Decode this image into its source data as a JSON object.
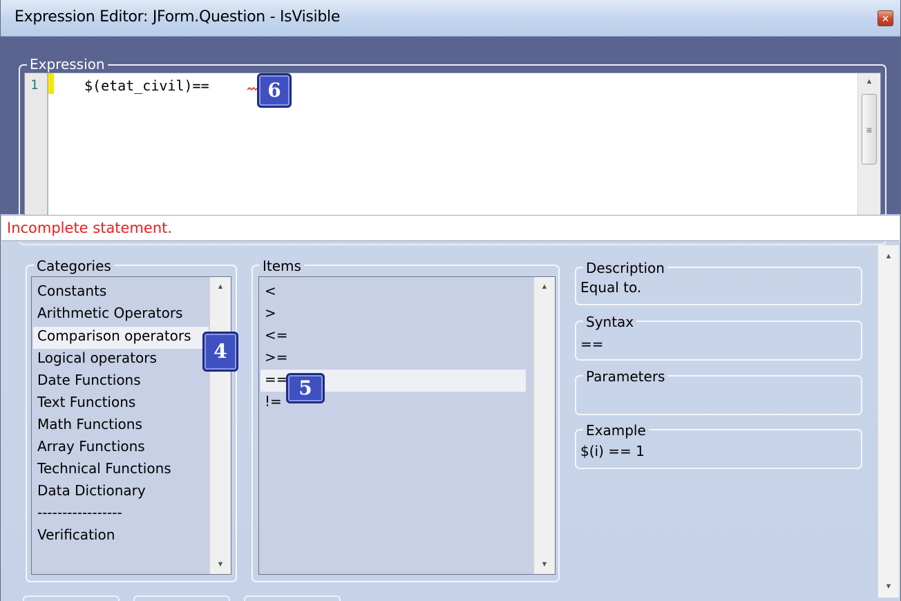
{
  "window": {
    "title": "Expression Editor: JForm.Question - IsVisible",
    "close_icon": "✕"
  },
  "expression": {
    "group_label": "Expression",
    "line_number": "1",
    "code": "$(etat_civil)=="
  },
  "status": {
    "message": "Incomplete statement.",
    "color": "#ee1c1c"
  },
  "categories": {
    "group_label": "Categories",
    "items": [
      "Constants",
      "Arithmetic Operators",
      "Comparison operators",
      "Logical operators",
      "Date Functions",
      "Text Functions",
      "Math Functions",
      "Array Functions",
      "Technical Functions",
      "Data Dictionary",
      "-----------------",
      "Verification"
    ],
    "selected": "Comparison operators"
  },
  "items": {
    "group_label": "Items",
    "list": [
      "<",
      ">",
      "<=",
      ">=",
      "==",
      "!="
    ],
    "selected": "=="
  },
  "description": {
    "label": "Description",
    "value": "Equal to."
  },
  "syntax": {
    "label": "Syntax",
    "value": "=="
  },
  "parameters": {
    "label": "Parameters",
    "value": ""
  },
  "example": {
    "label": "Example",
    "value": "$(i) == 1"
  },
  "badges": {
    "four": "4",
    "five": "5",
    "six": "6"
  },
  "colors": {
    "expression_panel": "#5a6491",
    "dialog_background": "#c8d3e8",
    "badge": "#3f51c0",
    "selection_highlight": "#eef0f6"
  }
}
